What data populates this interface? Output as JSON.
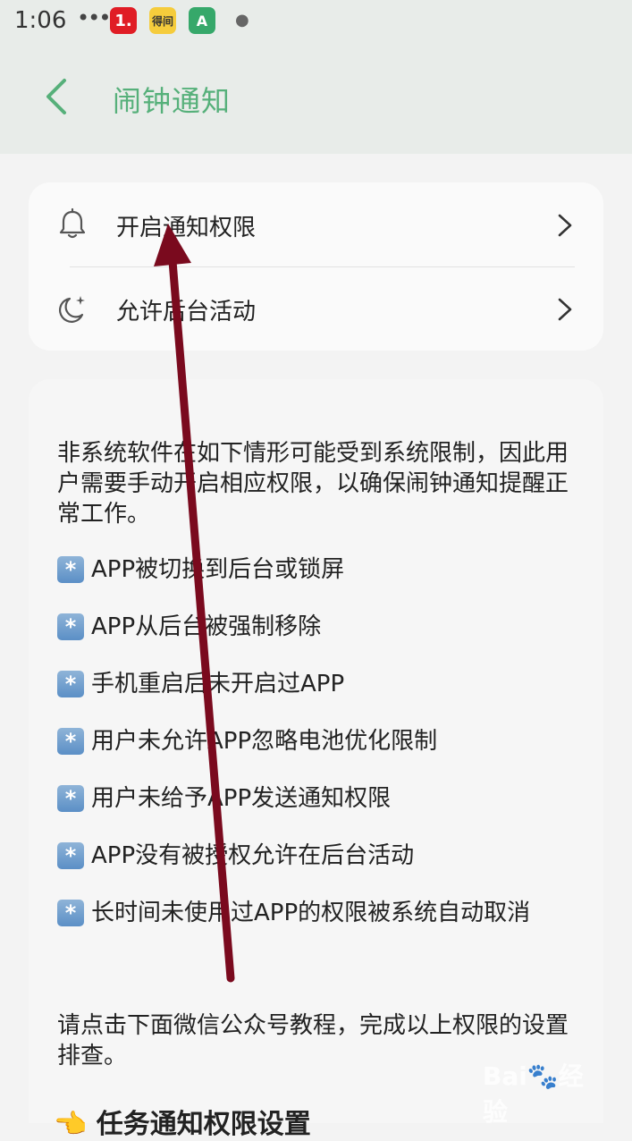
{
  "status_bar": {
    "time": "1:06",
    "dots": "•••",
    "icon1_text": "1.",
    "icon2_text": "得间",
    "icon3_text": "A"
  },
  "header": {
    "title": "闹钟通知"
  },
  "settings": {
    "items": [
      {
        "label": "开启通知权限",
        "icon": "bell-icon"
      },
      {
        "label": "允许后台活动",
        "icon": "moon-star-icon"
      }
    ]
  },
  "info": {
    "intro": "非系统软件在如下情形可能受到系统限制，因此用户需要手动开启相应权限，以确保闹钟通知提醒正常工作。",
    "bullets": [
      "APP被切换到后台或锁屏",
      "APP从后台被强制移除",
      "手机重启后未开启过APP",
      "用户未允许APP忽略电池优化限制",
      "用户未给予APP发送通知权限",
      "APP没有被授权允许在后台活动",
      "长时间未使用过APP的权限被系统自动取消"
    ],
    "bullet_badge": "*",
    "outro": "请点击下面微信公众号教程，完成以上权限的设置排查。",
    "section_title": "👈 任务通知权限设置"
  },
  "colors": {
    "accent_green": "#56b07a",
    "annotation_arrow": "#7a0a1e"
  }
}
